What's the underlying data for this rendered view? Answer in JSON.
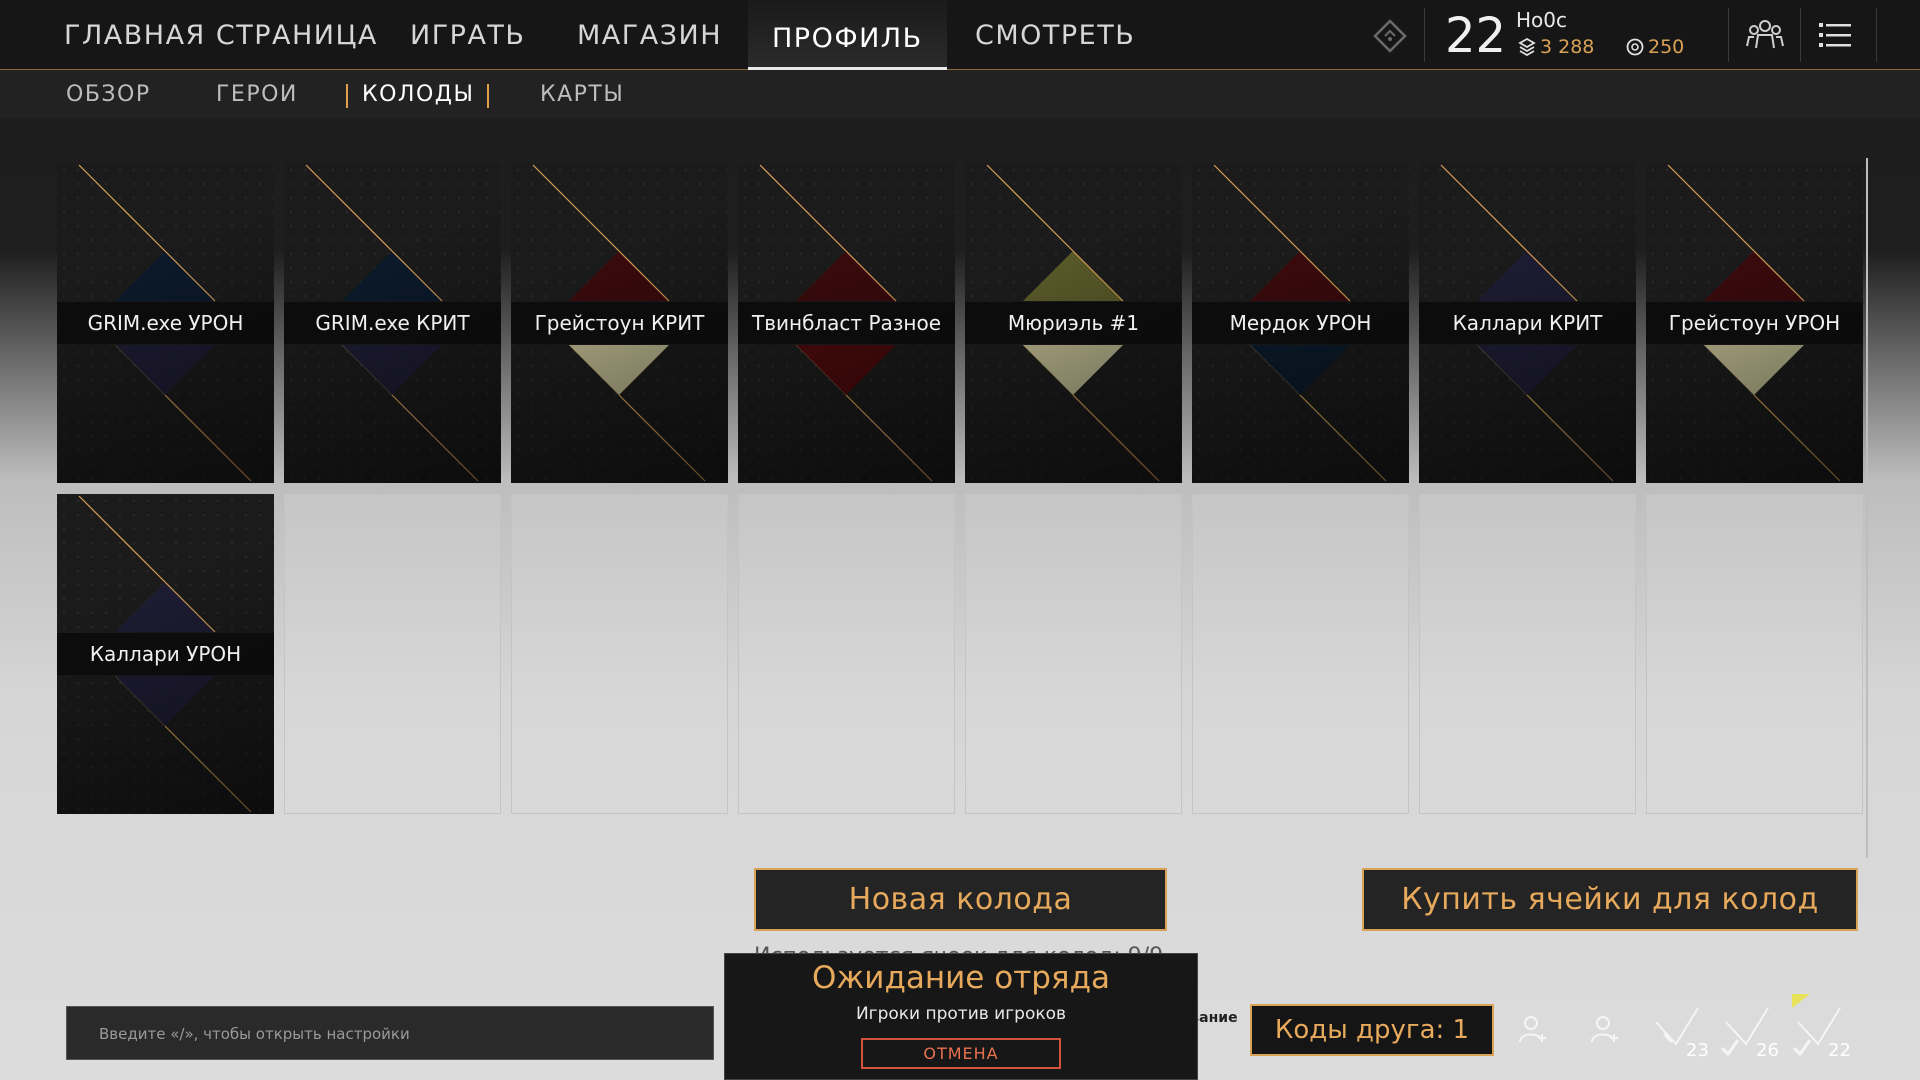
{
  "nav": {
    "items": [
      {
        "label": "ГЛАВНАЯ СТРАНИЦА"
      },
      {
        "label": "ИГРАТЬ"
      },
      {
        "label": "МАГАЗИН"
      },
      {
        "label": "ПРОФИЛЬ"
      },
      {
        "label": "СМОТРЕТЬ"
      }
    ],
    "active": "ПРОФИЛЬ"
  },
  "player": {
    "level": "22",
    "name": "Ho0c",
    "currency_1": "3 288",
    "currency_2": "250"
  },
  "subnav": {
    "items": [
      {
        "label": "ОБЗОР"
      },
      {
        "label": "ГЕРОИ"
      },
      {
        "label": "КОЛОДЫ"
      },
      {
        "label": "КАРТЫ"
      }
    ],
    "active": "КОЛОДЫ"
  },
  "decks": [
    {
      "name": "GRIM.exe УРОН",
      "top_color": "#0c1a2b",
      "bottom_color": "#1e1c33"
    },
    {
      "name": "GRIM.exe КРИТ",
      "top_color": "#0c1a2b",
      "bottom_color": "#1e1c33"
    },
    {
      "name": "Грейстоун КРИТ",
      "top_color": "#3a0a0c",
      "bottom_color": "#b9b48d"
    },
    {
      "name": "Твинбласт Разное",
      "top_color": "#3a0a0c",
      "bottom_color": "#4a0a0c"
    },
    {
      "name": "Мюриэль #1",
      "top_color": "#5a5a2a",
      "bottom_color": "#b9b48d"
    },
    {
      "name": "Мердок УРОН",
      "top_color": "#3a0a0c",
      "bottom_color": "#0c1a2b"
    },
    {
      "name": "Каллари КРИТ",
      "top_color": "#1e1c33",
      "bottom_color": "#1e1c33"
    },
    {
      "name": "Грейстоун УРОН",
      "top_color": "#3a0a0c",
      "bottom_color": "#b9b48d"
    },
    {
      "name": "Каллари УРОН",
      "top_color": "#1e1c33",
      "bottom_color": "#1e1c33"
    }
  ],
  "buttons": {
    "new_deck": "Новая колода",
    "buy_slots": "Купить ячейки для колод"
  },
  "slots_used": "Используется ячеек для колод: 9/9",
  "chat": {
    "placeholder": "Введите «/», чтобы открыть настройки"
  },
  "queue": {
    "title": "Ожидание отряда",
    "mode": "Игроки против игроков",
    "cancel": "ОТМЕНА"
  },
  "beta_text": "…, бета-тестирование",
  "friend_codes": "Коды друга: 1",
  "notification_counts": [
    "23",
    "26",
    "22"
  ],
  "colors": {
    "accent": "#d9a257",
    "cancel": "#d4523a"
  }
}
